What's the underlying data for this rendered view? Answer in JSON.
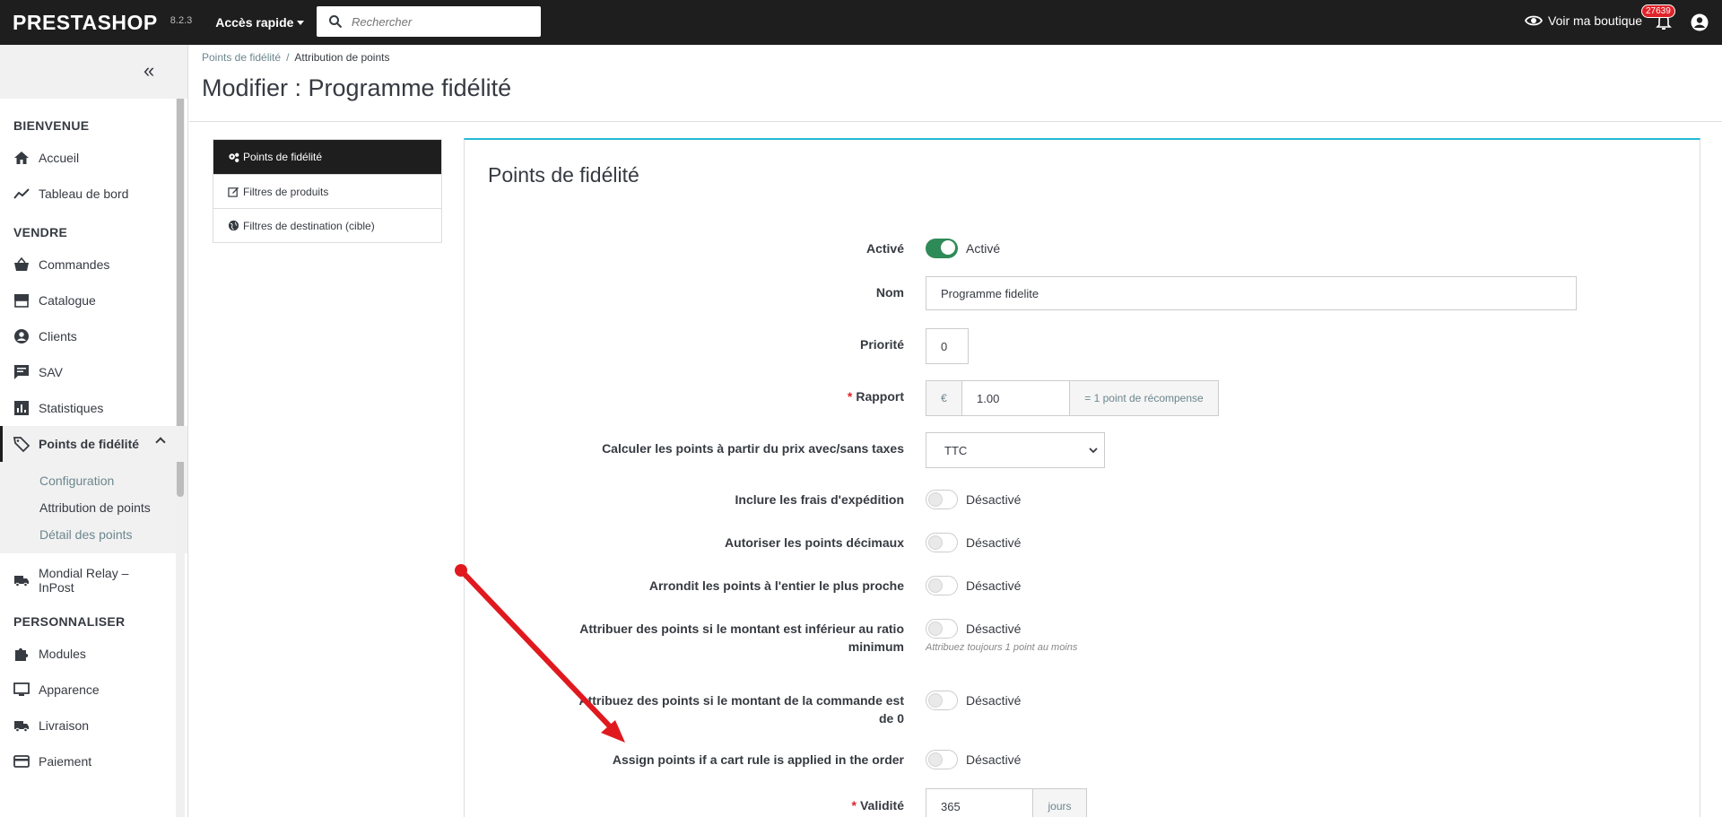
{
  "topbar": {
    "logo": "PRESTASHOP",
    "version": "8.2.3",
    "quick_access": "Accès rapide",
    "search_placeholder": "Rechercher",
    "view_shop": "Voir ma boutique",
    "notifications": "27639"
  },
  "sidebar": {
    "sections": {
      "welcome": "BIENVENUE",
      "sell": "VENDRE",
      "customize": "PERSONNALISER"
    },
    "items": {
      "home": "Accueil",
      "dashboard": "Tableau de bord",
      "orders": "Commandes",
      "catalog": "Catalogue",
      "customers": "Clients",
      "support": "SAV",
      "stats": "Statistiques",
      "loyalty": "Points de fidélité",
      "mondial_line1": "Mondial Relay –",
      "mondial_line2": "InPost",
      "modules": "Modules",
      "appearance": "Apparence",
      "shipping": "Livraison",
      "payment": "Paiement"
    },
    "loyalty_sub": [
      "Configuration",
      "Attribution de points",
      "Détail des points"
    ]
  },
  "header": {
    "breadcrumb": [
      "Points de fidélité",
      "Attribution de points"
    ],
    "title": "Modifier : Programme fidélité"
  },
  "tabs": [
    "Points de fidélité",
    "Filtres de produits",
    "Filtres de destination (cible)"
  ],
  "panel": {
    "title": "Points de fidélité",
    "active_label": "Activé",
    "active_state": "Activé",
    "name_label": "Nom",
    "name_value": "Programme fidelite",
    "priority_label": "Priorité",
    "priority_value": "0",
    "ratio_label": "Rapport",
    "ratio_currency": "€",
    "ratio_value": "1.00",
    "ratio_suffix": "= 1 point de récompense",
    "calc_label": "Calculer les points à partir du prix avec/sans taxes",
    "calc_value": "TTC",
    "shipping_label": "Inclure les frais d'expédition",
    "decimal_label": "Autoriser les points décimaux",
    "round_label": "Arrondit les points à l'entier le plus proche",
    "min_label_1": "Attribuer des points si le montant est inférieur au ratio",
    "min_label_2": "minimum",
    "min_help": "Attribuez toujours 1 point au moins",
    "zero_label_1": "Attribuez des points si le montant de la commande est",
    "zero_label_2": "de 0",
    "cartrule_label": "Assign points if a cart rule is applied in the order",
    "validity_label": "Validité",
    "validity_value": "365",
    "validity_unit": "jours",
    "off": "Désactivé"
  }
}
